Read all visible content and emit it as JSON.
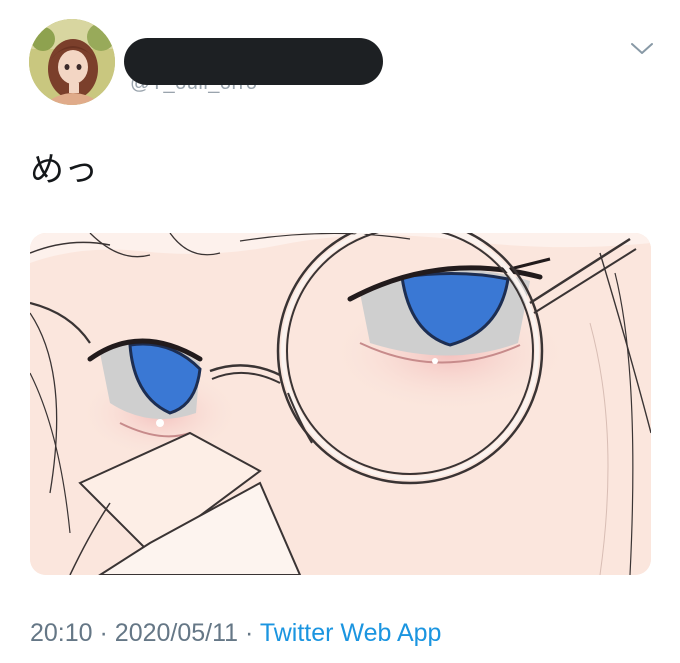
{
  "tweet": {
    "author_handle_fragment": "@T_ouli_orro",
    "text": "めっ",
    "time": "20:10",
    "separator": "·",
    "date": "2020/05/11",
    "source": "Twitter Web App"
  },
  "icons": {
    "caret": "chevron-down-icon"
  },
  "colors": {
    "link": "#1b95e0",
    "meta": "#657786",
    "redaction": "#1d2023",
    "iris": "#3a78d4"
  }
}
